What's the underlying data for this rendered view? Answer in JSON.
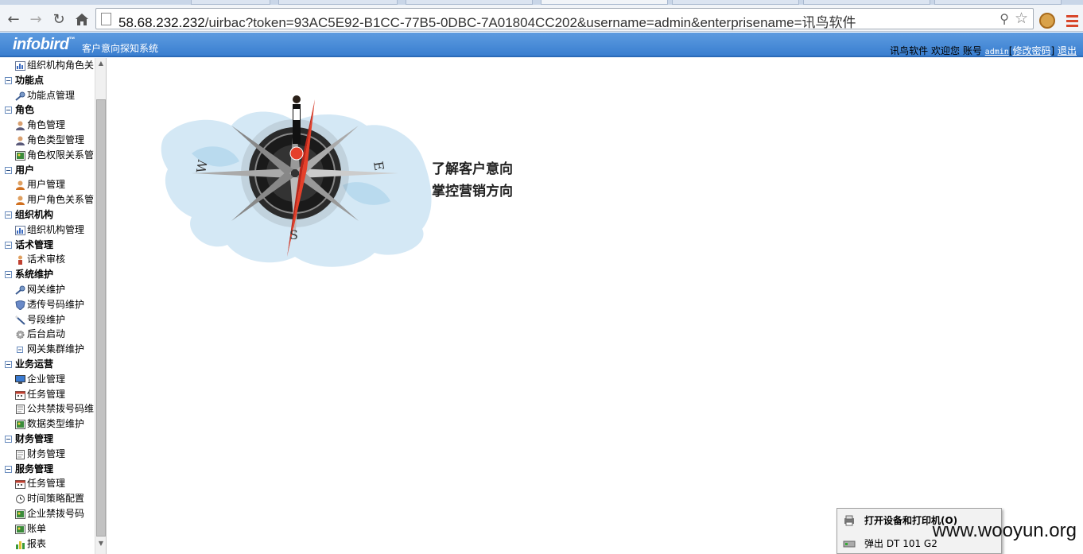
{
  "browser": {
    "url_host": "58.68.232.232",
    "url_rest": "/uirbac?token=93AC5E92-B1CC-77B5-0DBC-7A01804CC202&username=admin&enterprisename=讯鸟软件",
    "back_icon": "back-arrow-icon",
    "forward_icon": "forward-arrow-icon",
    "reload_icon": "reload-icon",
    "home_icon": "home-icon"
  },
  "header": {
    "logo": "infobird",
    "tm": "™",
    "system_name": "客户意向探知系统",
    "company": "讯鸟软件",
    "welcome": "欢迎您",
    "account_label": "账号",
    "username": "admin",
    "change_password": "修改密码",
    "logout": "退出",
    "accent_color": "#3a7fd0"
  },
  "sidebar": {
    "tree": [
      {
        "type": "leaf",
        "label": "组织机构角色关",
        "icon": "chart"
      },
      {
        "type": "group",
        "label": "功能点"
      },
      {
        "type": "leaf",
        "label": "功能点管理",
        "icon": "key"
      },
      {
        "type": "group",
        "label": "角色"
      },
      {
        "type": "leaf",
        "label": "角色管理",
        "icon": "user"
      },
      {
        "type": "leaf",
        "label": "角色类型管理",
        "icon": "user"
      },
      {
        "type": "leaf",
        "label": "角色权限关系管",
        "icon": "picture"
      },
      {
        "type": "group",
        "label": "用户"
      },
      {
        "type": "leaf",
        "label": "用户管理",
        "icon": "user-orange"
      },
      {
        "type": "leaf",
        "label": "用户角色关系管",
        "icon": "user-orange"
      },
      {
        "type": "group",
        "label": "组织机构"
      },
      {
        "type": "leaf",
        "label": "组织机构管理",
        "icon": "chart"
      },
      {
        "type": "group",
        "label": "话术管理"
      },
      {
        "type": "leaf",
        "label": "话术审核",
        "icon": "person-small"
      },
      {
        "type": "group",
        "label": "系统维护"
      },
      {
        "type": "leaf",
        "label": "网关维护",
        "icon": "key"
      },
      {
        "type": "leaf",
        "label": "透传号码维护",
        "icon": "shield"
      },
      {
        "type": "leaf",
        "label": "号段维护",
        "icon": "wand"
      },
      {
        "type": "leaf",
        "label": "后台启动",
        "icon": "gear"
      },
      {
        "type": "leaf",
        "label": "网关集群维护",
        "icon": "minus-box"
      },
      {
        "type": "group",
        "label": "业务运营"
      },
      {
        "type": "leaf",
        "label": "企业管理",
        "icon": "monitor"
      },
      {
        "type": "leaf",
        "label": "任务管理",
        "icon": "calendar"
      },
      {
        "type": "leaf",
        "label": "公共禁拨号码维",
        "icon": "document"
      },
      {
        "type": "leaf",
        "label": "数据类型维护",
        "icon": "picture"
      },
      {
        "type": "group",
        "label": "财务管理"
      },
      {
        "type": "leaf",
        "label": "财务管理",
        "icon": "document"
      },
      {
        "type": "group",
        "label": "服务管理"
      },
      {
        "type": "leaf",
        "label": "任务管理",
        "icon": "calendar"
      },
      {
        "type": "leaf",
        "label": "时间策略配置",
        "icon": "clock"
      },
      {
        "type": "leaf",
        "label": "企业禁拨号码",
        "icon": "picture"
      },
      {
        "type": "leaf",
        "label": "账单",
        "icon": "picture"
      },
      {
        "type": "leaf",
        "label": "报表",
        "icon": "bar-chart"
      }
    ]
  },
  "main": {
    "compass_letters": [
      "W",
      "E",
      "S"
    ],
    "slogan_line1": "了解客户意向",
    "slogan_line2": "掌控营销方向"
  },
  "tray_menu": {
    "item1": "打开设备和打印机(O)",
    "item2": "弹出 DT 101 G2"
  },
  "watermark": "www.wooyun.org"
}
